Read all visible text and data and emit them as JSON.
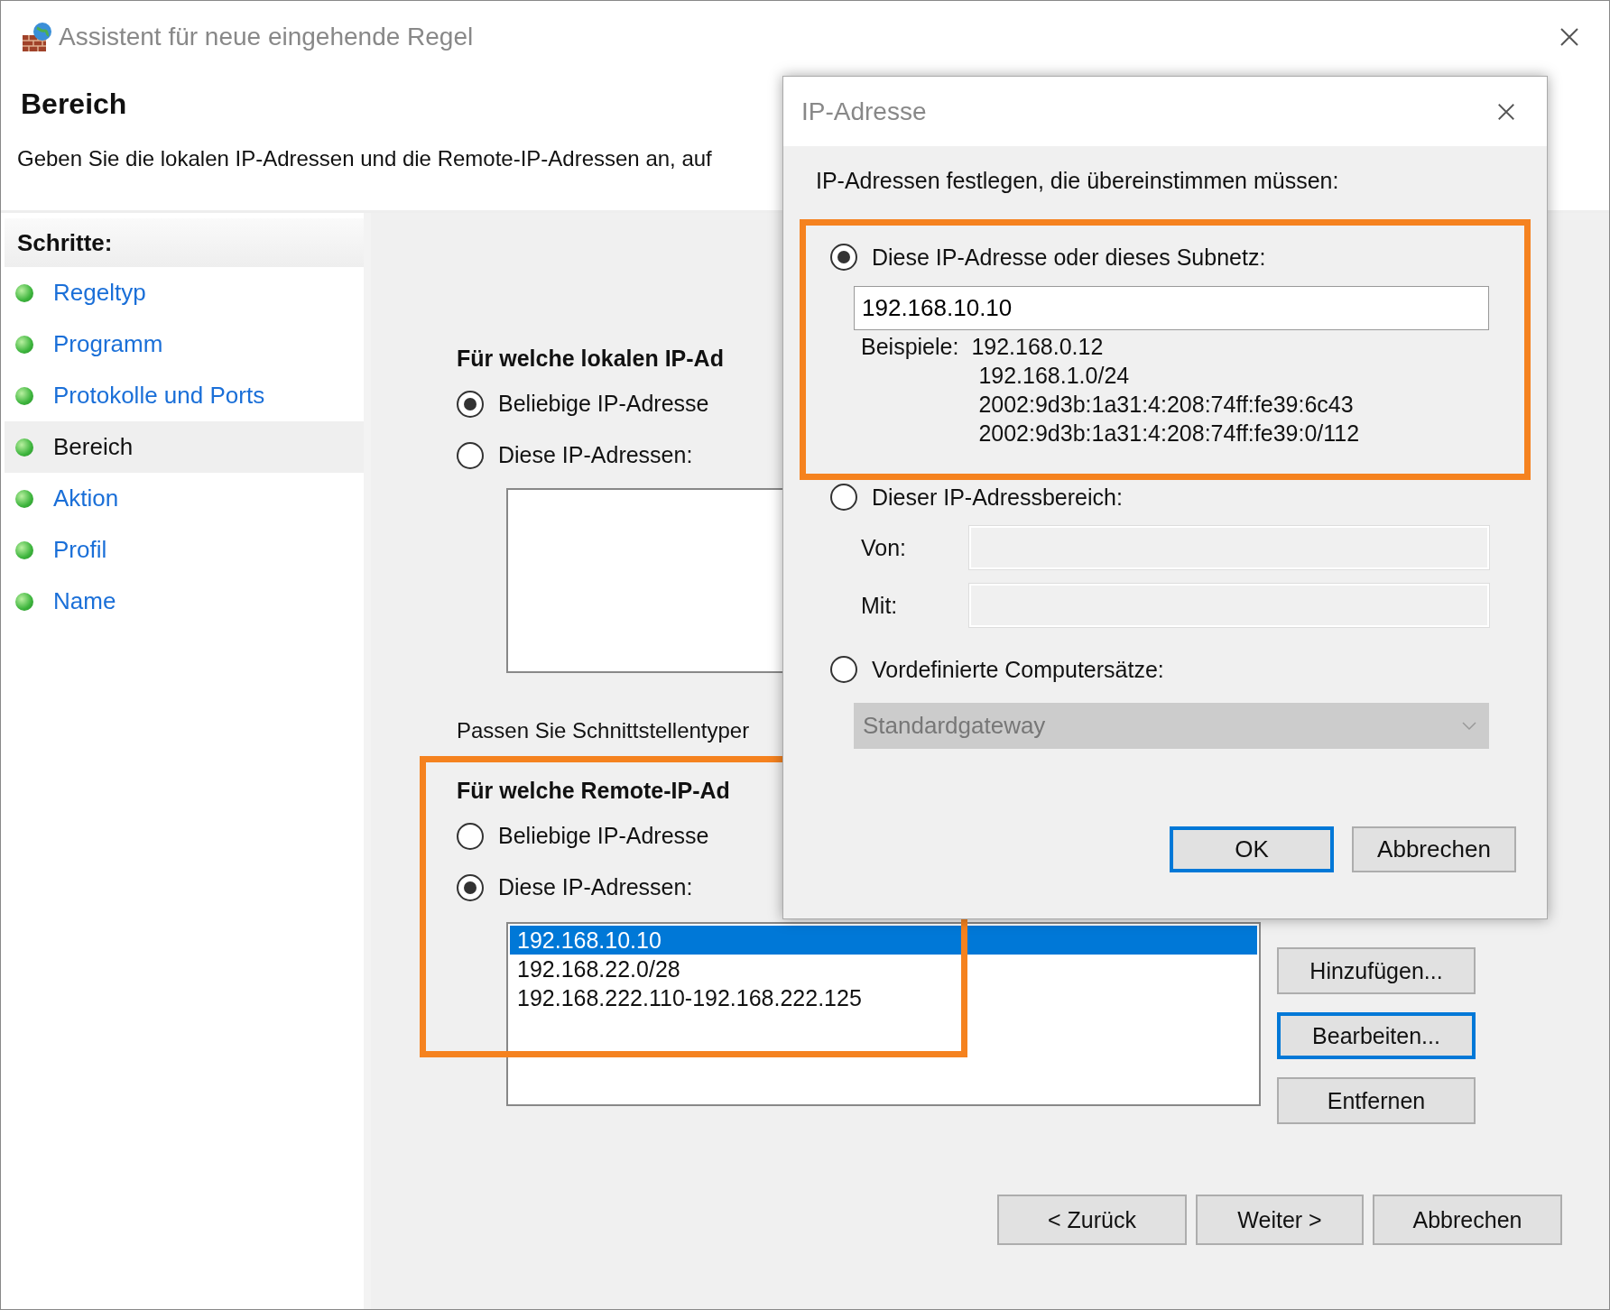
{
  "window": {
    "title": "Assistent für neue eingehende Regel"
  },
  "header": {
    "title": "Bereich",
    "description": "Geben Sie die lokalen IP-Adressen und die Remote-IP-Adressen an, auf"
  },
  "steps": {
    "title": "Schritte:",
    "items": [
      {
        "label": "Regeltyp",
        "selected": false
      },
      {
        "label": "Programm",
        "selected": false
      },
      {
        "label": "Protokolle und Ports",
        "selected": false
      },
      {
        "label": "Bereich",
        "selected": true
      },
      {
        "label": "Aktion",
        "selected": false
      },
      {
        "label": "Profil",
        "selected": false
      },
      {
        "label": "Name",
        "selected": false
      }
    ]
  },
  "local": {
    "heading": "Für welche lokalen IP-Ad",
    "options": [
      {
        "label": "Beliebige IP-Adresse",
        "selected": true
      },
      {
        "label": "Diese IP-Adressen:",
        "selected": false
      }
    ]
  },
  "interface_text": "Passen Sie Schnittstellentyper",
  "remote": {
    "heading": "Für welche Remote-IP-Ad",
    "options": [
      {
        "label": "Beliebige IP-Adresse",
        "selected": false
      },
      {
        "label": "Diese IP-Adressen:",
        "selected": true
      }
    ],
    "addresses": [
      {
        "text": "192.168.10.10",
        "selected": true
      },
      {
        "text": "192.168.22.0/28",
        "selected": false
      },
      {
        "text": "192.168.222.110-192.168.222.125",
        "selected": false
      }
    ],
    "buttons": [
      {
        "label": "Hinzufügen...",
        "focused": false
      },
      {
        "label": "Bearbeiten...",
        "focused": true
      },
      {
        "label": "Entfernen",
        "focused": false
      }
    ]
  },
  "footer": {
    "buttons": [
      "< Zurück",
      "Weiter >",
      "Abbrechen"
    ]
  },
  "dialog": {
    "title": "IP-Adresse",
    "prompt": "IP-Adressen festlegen, die übereinstimmen müssen:",
    "options": [
      {
        "kind": "subnet",
        "label": "Diese IP-Adresse oder dieses Subnetz:",
        "selected": true,
        "value": "192.168.10.10",
        "examples_label": "Beispiele:",
        "examples": [
          "192.168.0.12",
          "192.168.1.0/24",
          "2002:9d3b:1a31:4:208:74ff:fe39:6c43",
          "2002:9d3b:1a31:4:208:74ff:fe39:0/112"
        ]
      },
      {
        "kind": "range",
        "label": "Dieser IP-Adressbereich:",
        "selected": false,
        "fields": [
          {
            "label": "Von:"
          },
          {
            "label": "Mit:"
          }
        ]
      },
      {
        "kind": "predefined",
        "label": "Vordefinierte Computersätze:",
        "selected": false,
        "value": "Standardgateway"
      }
    ],
    "buttons": [
      {
        "label": "OK",
        "default": true
      },
      {
        "label": "Abbrechen",
        "default": false
      }
    ]
  }
}
